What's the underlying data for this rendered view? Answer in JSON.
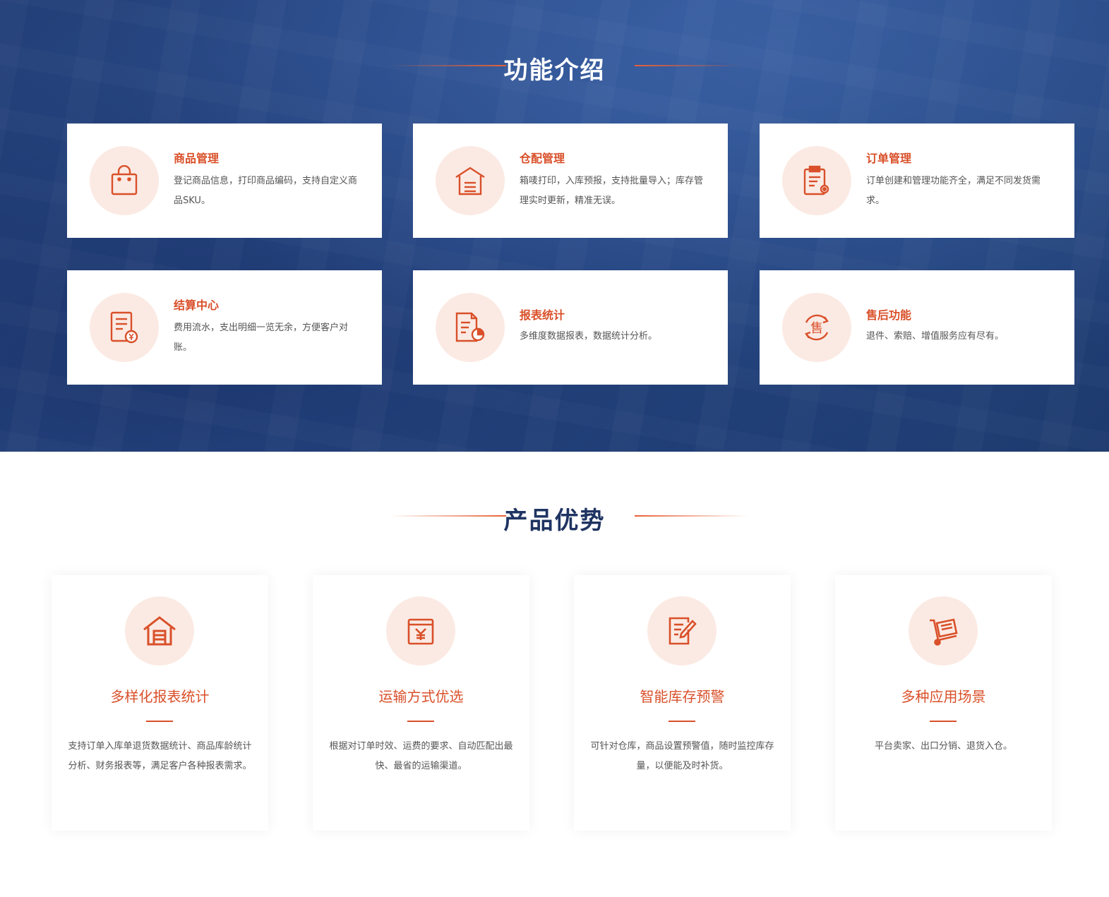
{
  "features_section": {
    "title": "功能介绍",
    "cards": [
      {
        "title": "商品管理",
        "desc": "登记商品信息，打印商品编码，支持自定义商品SKU。",
        "icon": "shopping-bag-icon"
      },
      {
        "title": "仓配管理",
        "desc": "箱唛打印，入库预报，支持批量导入；库存管理实时更新，精准无误。",
        "icon": "warehouse-icon"
      },
      {
        "title": "订单管理",
        "desc": "订单创建和管理功能齐全，满足不同发货需求。",
        "icon": "clipboard-gear-icon"
      },
      {
        "title": "结算中心",
        "desc": "费用流水，支出明细一览无余，方便客户对账。",
        "icon": "invoice-yen-icon"
      },
      {
        "title": "报表统计",
        "desc": "多维度数据报表，数据统计分析。",
        "icon": "report-chart-icon"
      },
      {
        "title": "售后功能",
        "desc": "退件、索赔、增值服务应有尽有。",
        "icon": "after-sales-icon"
      }
    ]
  },
  "advantages_section": {
    "title": "产品优势",
    "cards": [
      {
        "title": "多样化报表统计",
        "desc": "支持订单入库单退货数据统计、商品库龄统计分析、财务报表等，满足客户各种报表需求。",
        "icon": "warehouse-home-icon"
      },
      {
        "title": "运输方式优选",
        "desc": "根据对订单时效、运费的要求、自动匹配出最快、最省的运输渠道。",
        "icon": "yen-calendar-icon"
      },
      {
        "title": "智能库存预警",
        "desc": "可针对仓库，商品设置预警值，随时监控库存量，以便能及时补货。",
        "icon": "document-edit-icon"
      },
      {
        "title": "多种应用场景",
        "desc": "平台卖家、出口分销、退货入仓。",
        "icon": "hand-truck-icon"
      }
    ]
  },
  "colors": {
    "accent": "#d9502a",
    "hero_blue": "#2c4f8f",
    "title_navy": "#1f3462",
    "icon_bg": "#fbeae3"
  }
}
